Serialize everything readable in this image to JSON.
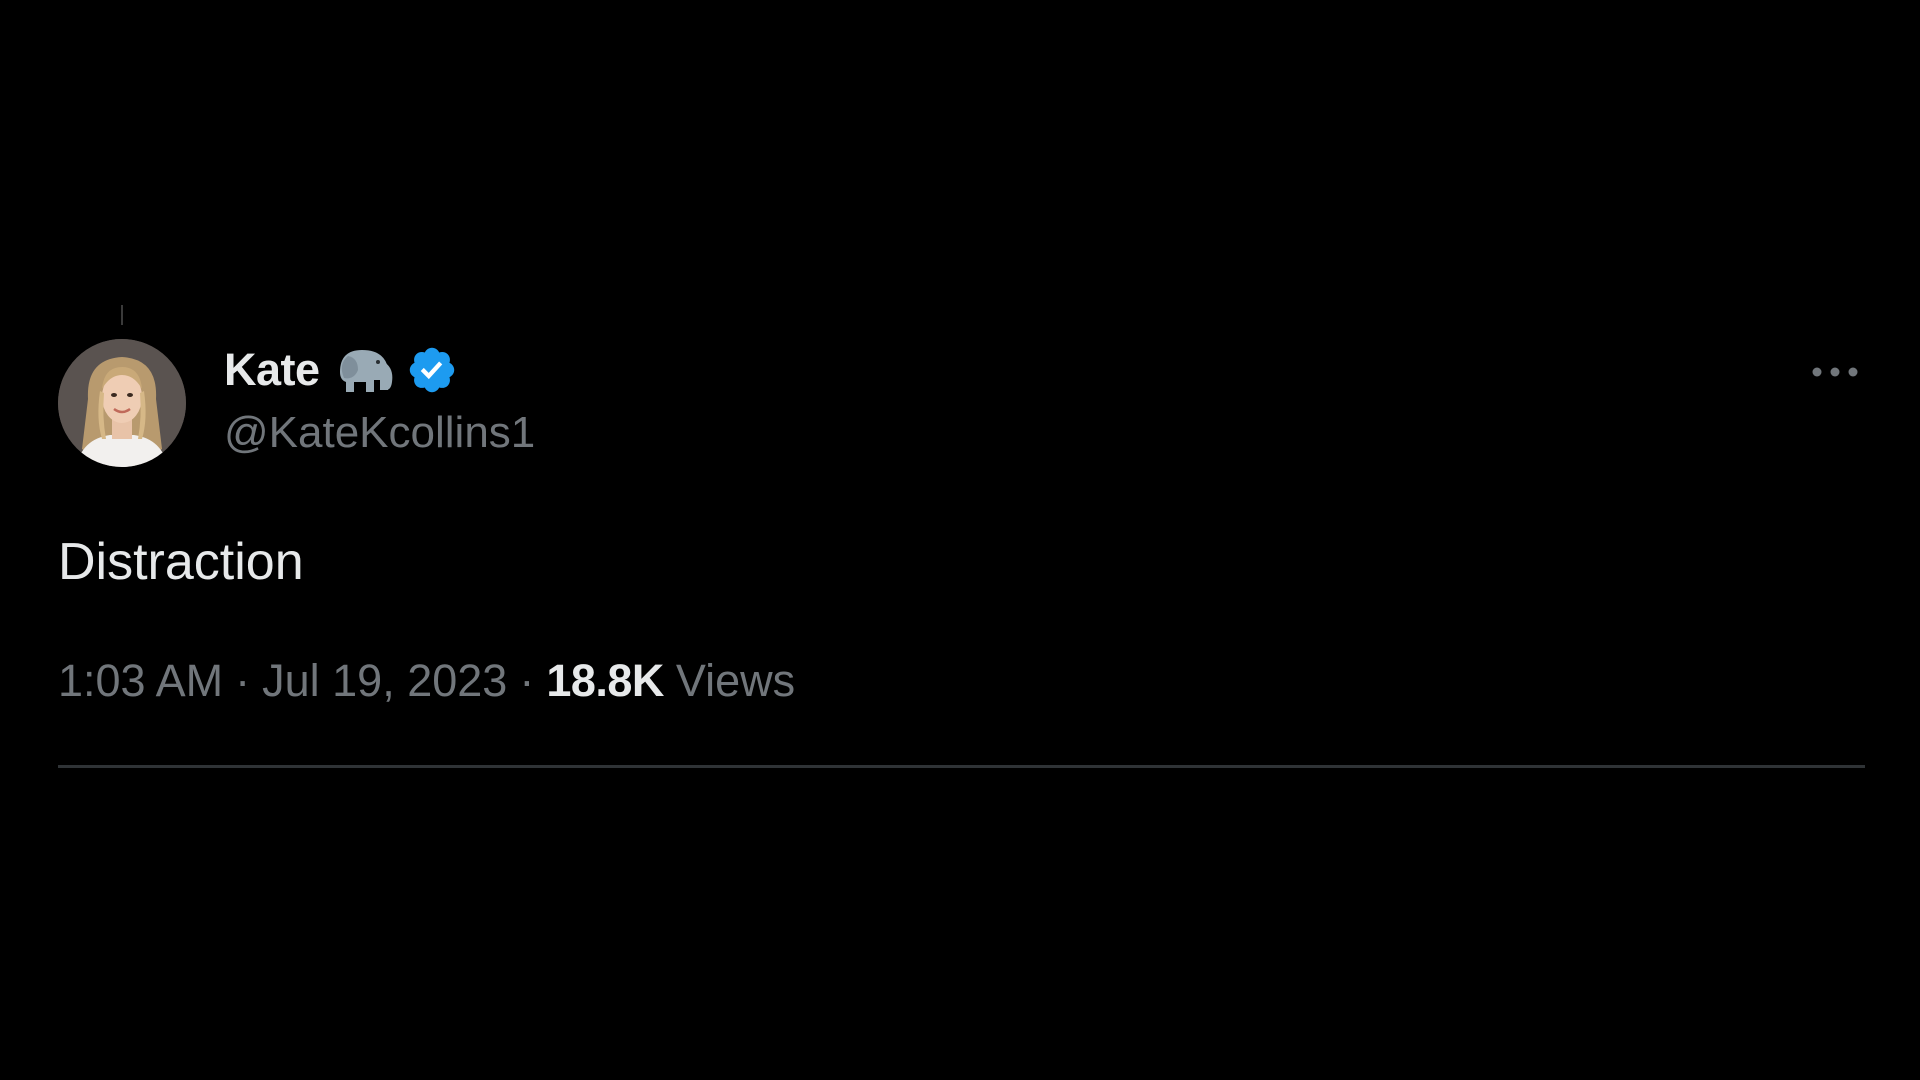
{
  "tweet": {
    "author": {
      "display_name": "Kate",
      "name_emoji": "elephant-emoji",
      "verified_icon": "verified-badge-icon",
      "handle": "@KateKcollins1"
    },
    "more_icon": "more-options-icon",
    "text": "Distraction",
    "meta": {
      "time": "1:03 AM",
      "separator": "·",
      "date": "Jul 19, 2023",
      "views_count": "18.8K",
      "views_label": "Views"
    }
  },
  "colors": {
    "background": "#000000",
    "primary_text": "#e7e9ea",
    "secondary_text": "#71767b",
    "verified_blue": "#1d9bf0",
    "divider": "#2f3336"
  }
}
